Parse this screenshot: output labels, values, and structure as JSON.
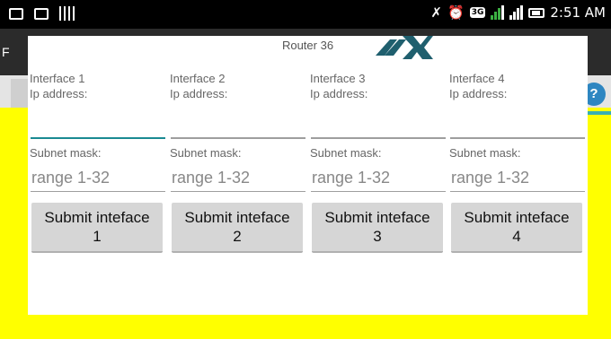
{
  "status_bar": {
    "time": "2:51 AM",
    "icons": [
      "message-icon",
      "chat-icon",
      "barcode-icon",
      "mute-icon",
      "alarm-icon",
      "3g-icon",
      "signal-green-icon",
      "signal-icon",
      "battery-charging-icon"
    ]
  },
  "colors": {
    "background_yellow": "#ffff00",
    "focus_teal": "#1a8a92",
    "button_gray": "#d6d6d6"
  },
  "appbar": {
    "partial_letter": "F"
  },
  "dialog": {
    "title": "Router 36",
    "columns": [
      {
        "interface_label": "Interface 1",
        "ip_label": "Ip address:",
        "subnet_label": "Subnet mask:",
        "subnet_placeholder": "range 1-32",
        "submit_label": "Submit inteface\n1"
      },
      {
        "interface_label": "Interface 2",
        "ip_label": "Ip address:",
        "subnet_label": "Subnet mask:",
        "subnet_placeholder": "range 1-32",
        "submit_label": "Submit inteface\n2"
      },
      {
        "interface_label": "Interface 3",
        "ip_label": "Ip address:",
        "subnet_label": "Subnet mask:",
        "subnet_placeholder": "range 1-32",
        "submit_label": "Submit inteface\n3"
      },
      {
        "interface_label": "Interface 4",
        "ip_label": "Ip address:",
        "subnet_label": "Subnet mask:",
        "subnet_placeholder": "range 1-32",
        "submit_label": "Submit inteface\n4"
      }
    ]
  },
  "help_button": {
    "label": "?"
  }
}
